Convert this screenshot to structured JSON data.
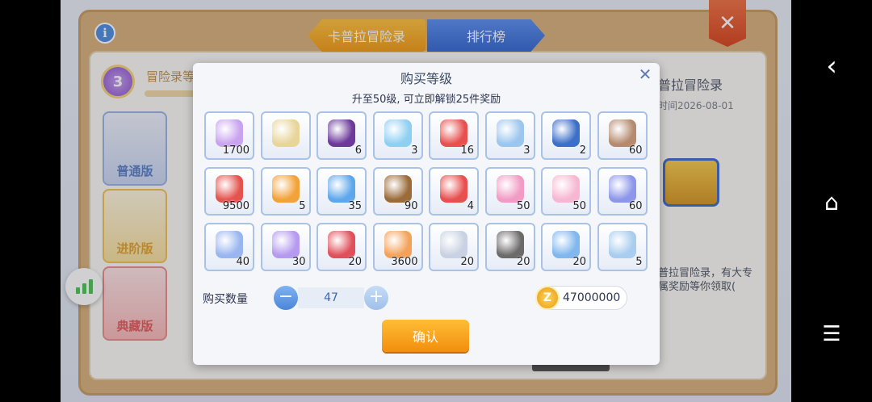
{
  "header": {
    "info_label": "i",
    "tab_adventure": "卡普拉冒险录",
    "tab_rank": "排行榜",
    "close_label": "✕"
  },
  "left": {
    "level": "3",
    "level_label": "冒险录等",
    "versions": [
      "普通版",
      "进阶版",
      "典藏版"
    ]
  },
  "right": {
    "title": "普拉冒险录",
    "time": "时间2026-08-01",
    "desc": "普拉冒险录，有大专属奖励等你领取("
  },
  "dialog": {
    "title": "购买等级",
    "close_label": "✕",
    "subtitle": "升至50级, 可立即解锁25件奖励",
    "qty_label": "购买数量",
    "qty_value": "47",
    "minus_label": "−",
    "plus_label": "+",
    "coin_symbol": "Z",
    "cost": "47000000",
    "confirm": "确认"
  },
  "rewards": [
    {
      "icon": "card-icon",
      "count": "1700",
      "color": "#c9a3f0"
    },
    {
      "icon": "horn-icon",
      "count": "",
      "color": "#e8d59a"
    },
    {
      "icon": "egg-icon",
      "count": "6",
      "color": "#6c3a9a"
    },
    {
      "icon": "crystal-icon",
      "count": "3",
      "color": "#8fd0f2"
    },
    {
      "icon": "gift-box-icon",
      "count": "16",
      "color": "#e85050"
    },
    {
      "icon": "ice-bed-icon",
      "count": "3",
      "color": "#9cc6ee"
    },
    {
      "icon": "blue-chest-icon",
      "count": "2",
      "color": "#3c6fc8"
    },
    {
      "icon": "cat-coin-icon",
      "count": "60",
      "color": "#b58b70"
    },
    {
      "icon": "pink-orb-icon",
      "count": "9500",
      "color": "#e4544e"
    },
    {
      "icon": "ticket-card-icon",
      "count": "5",
      "color": "#f2a23a"
    },
    {
      "icon": "blue-ticket-icon",
      "count": "35",
      "color": "#5fa7ec"
    },
    {
      "icon": "treasure-chest-icon",
      "count": "90",
      "color": "#9b6b3a"
    },
    {
      "icon": "gift-box-icon",
      "count": "4",
      "color": "#e85050"
    },
    {
      "icon": "pink-crystal-icon",
      "count": "50",
      "color": "#f29bc4"
    },
    {
      "icon": "pink-dust-icon",
      "count": "50",
      "color": "#f7b7d2"
    },
    {
      "icon": "blue-gem-icon",
      "count": "60",
      "color": "#8d96ea"
    },
    {
      "icon": "rainbow-crystal-icon",
      "count": "40",
      "color": "#9ab6f0"
    },
    {
      "icon": "potion-icon",
      "count": "30",
      "color": "#b59af0"
    },
    {
      "icon": "red-coupon-icon",
      "count": "20",
      "color": "#e0505a"
    },
    {
      "icon": "shell-icon",
      "count": "3600",
      "color": "#f4a25a"
    },
    {
      "icon": "silver-ore-icon",
      "count": "20",
      "color": "#c9d2e2"
    },
    {
      "icon": "dark-stone-icon",
      "count": "20",
      "color": "#6d6a6a"
    },
    {
      "icon": "ice-shard-icon",
      "count": "20",
      "color": "#7fb7ee"
    },
    {
      "icon": "blue-tile-icon",
      "count": "5",
      "color": "#a9cdee"
    }
  ],
  "nav": {
    "back": "‹",
    "home": "⌂",
    "menu": "☰"
  }
}
